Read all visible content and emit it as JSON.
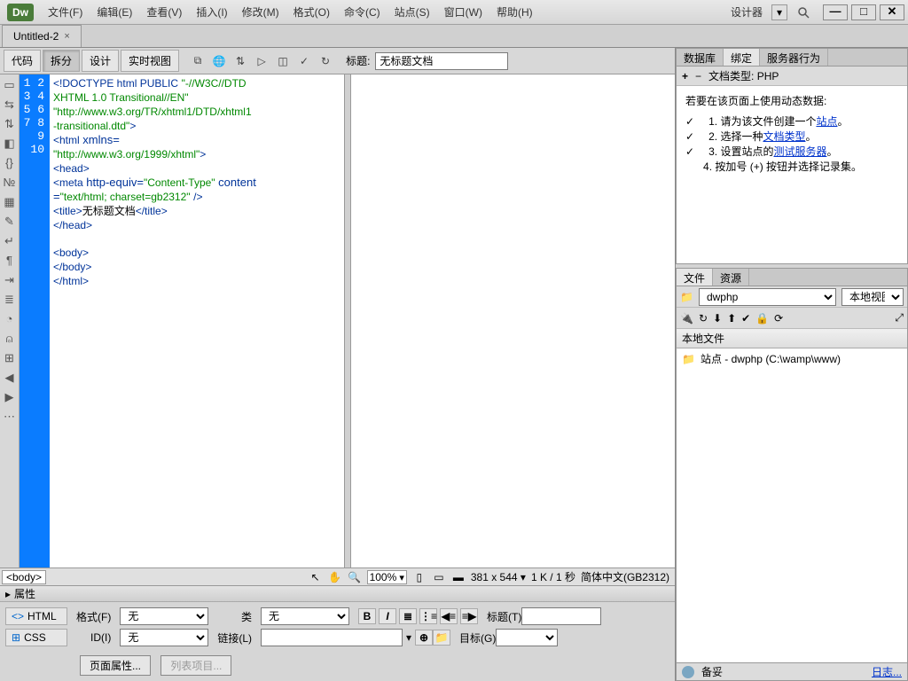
{
  "app": {
    "logo": "Dw"
  },
  "menus": [
    "文件(F)",
    "编辑(E)",
    "查看(V)",
    "插入(I)",
    "修改(M)",
    "格式(O)",
    "命令(C)",
    "站点(S)",
    "窗口(W)",
    "帮助(H)"
  ],
  "designer_label": "设计器",
  "doc_tabs": [
    {
      "title": "Untitled-2",
      "close": "×"
    }
  ],
  "view_toolbar": {
    "code": "代码",
    "split": "拆分",
    "design": "设计",
    "live": "实时视图",
    "title_label": "标题:",
    "title_value": "无标题文档"
  },
  "code": {
    "line_numbers": [
      "1",
      "2",
      "3",
      "4",
      "5",
      "6",
      "7",
      "8",
      "9",
      "10"
    ],
    "lines": [
      "<!DOCTYPE html PUBLIC \"-//W3C//DTD",
      "XHTML 1.0 Transitional//EN\"",
      "\"http://www.w3.org/TR/xhtml1/DTD/xhtml1",
      "-transitional.dtd\">",
      "<html xmlns=",
      "\"http://www.w3.org/1999/xhtml\">",
      "<head>",
      "<meta http-equiv=\"Content-Type\" content",
      "=\"text/html; charset=gb2312\" />",
      "<title>无标题文档</title>",
      "</head>",
      "",
      "<body>",
      "</body>",
      "</html>"
    ]
  },
  "tagbar": {
    "tag": "<body>",
    "zoom": "100%",
    "dims": "381 x 544",
    "filesize": "1 K / 1 秒",
    "encoding": "简体中文(GB2312)"
  },
  "properties": {
    "title": "属性",
    "html_btn": "HTML",
    "css_btn": "CSS",
    "format_label": "格式(F)",
    "format_value": "无",
    "class_label": "类",
    "class_value": "无",
    "id_label": "ID(I)",
    "id_value": "无",
    "link_label": "链接(L)",
    "link_value": "",
    "title_label": "标题(T)",
    "target_label": "目标(G)",
    "page_props_btn": "页面属性...",
    "list_items_btn": "列表项目..."
  },
  "right": {
    "bind_tabs": [
      "数据库",
      "绑定",
      "服务器行为"
    ],
    "doc_type_label": "文档类型: PHP",
    "plus": "+",
    "minus": "−",
    "help_intro": "若要在该页面上使用动态数据:",
    "steps": [
      {
        "n": "1.",
        "prefix": "请为该文件创建一个",
        "link": "站点",
        "suffix": "。"
      },
      {
        "n": "2.",
        "prefix": "选择一种",
        "link": "文档类型",
        "suffix": "。"
      },
      {
        "n": "3.",
        "prefix": "设置站点的",
        "link": "测试服务器",
        "suffix": "。"
      },
      {
        "n": "4.",
        "prefix": "按加号 (+) 按钮并选择记录集。",
        "link": "",
        "suffix": ""
      }
    ],
    "files_tabs": [
      "文件",
      "资源"
    ],
    "site_select": "dwphp",
    "view_select": "本地视图",
    "local_files_header": "本地文件",
    "site_row": "站点 - dwphp (C:\\wamp\\www)",
    "ready": "备妥",
    "log": "日志..."
  }
}
